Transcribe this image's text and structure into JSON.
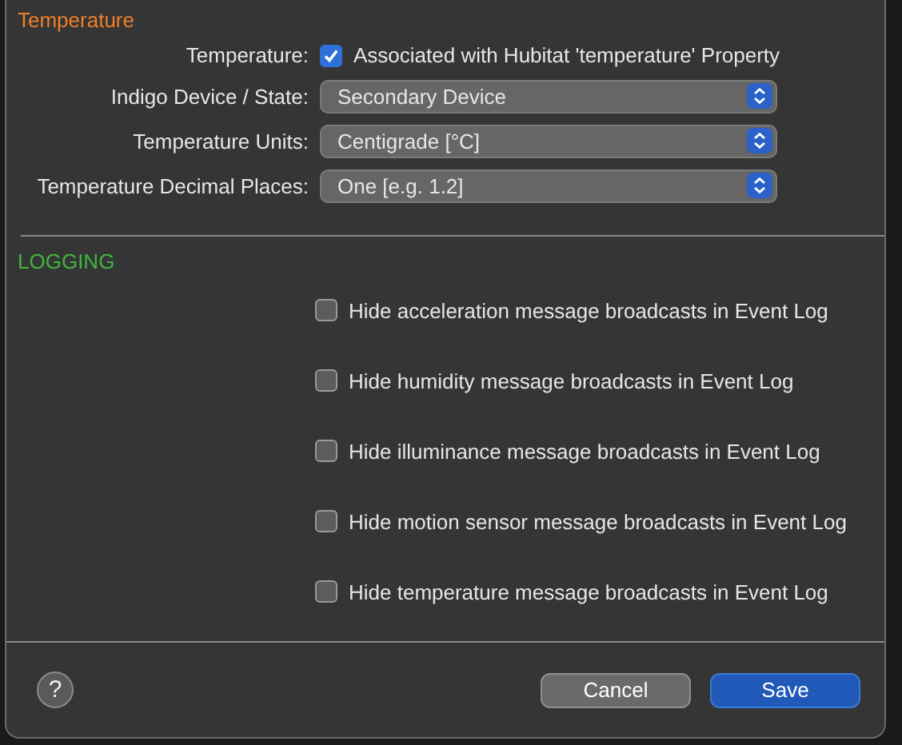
{
  "temperature_section": {
    "title": "Temperature",
    "checkbox_row": {
      "label": "Temperature:",
      "text": "Associated with Hubitat 'temperature' Property",
      "checked": true
    },
    "popups": [
      {
        "label": "Indigo Device / State:",
        "value": "Secondary Device"
      },
      {
        "label": "Temperature Units:",
        "value": "Centigrade [°C]"
      },
      {
        "label": "Temperature Decimal Places:",
        "value": "One [e.g. 1.2]"
      }
    ]
  },
  "logging_section": {
    "title": "LOGGING",
    "options": [
      {
        "text": "Hide acceleration message broadcasts in Event Log",
        "checked": false
      },
      {
        "text": "Hide humidity message broadcasts in Event Log",
        "checked": false
      },
      {
        "text": "Hide illuminance message broadcasts in Event Log",
        "checked": false
      },
      {
        "text": "Hide motion sensor message broadcasts in Event Log",
        "checked": false
      },
      {
        "text": "Hide temperature message broadcasts in Event Log",
        "checked": false
      }
    ]
  },
  "footer": {
    "help": "?",
    "buttons": [
      {
        "label": "Cancel",
        "kind": "secondary"
      },
      {
        "label": "Save",
        "kind": "primary"
      }
    ]
  }
}
